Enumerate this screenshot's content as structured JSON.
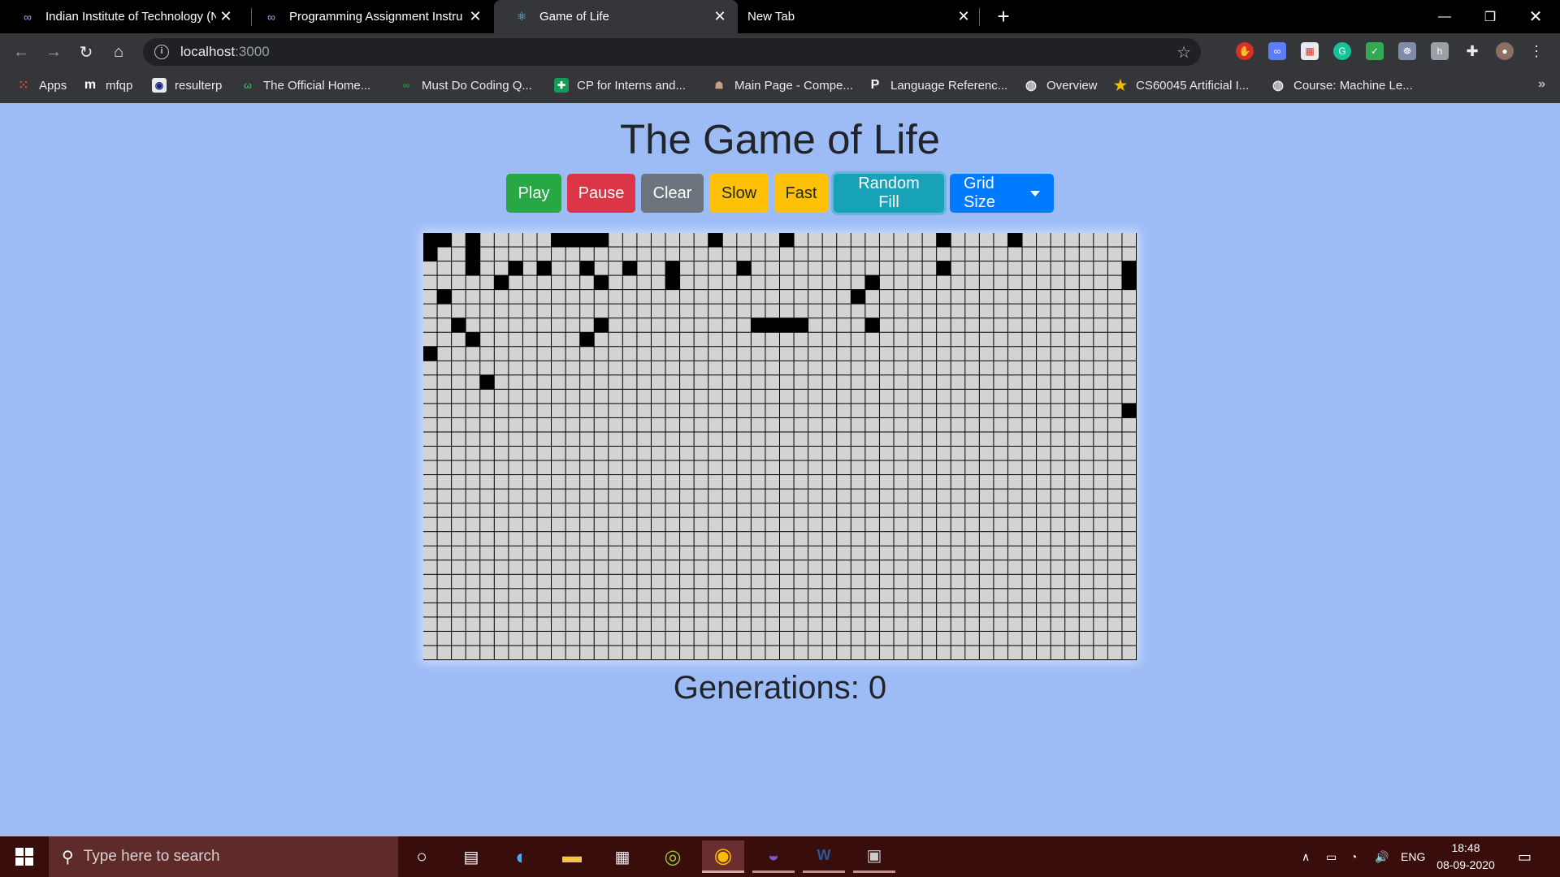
{
  "browser": {
    "tabs": [
      {
        "title": "Indian Institute of Technology (N",
        "icon": "coursera-icon",
        "active": false
      },
      {
        "title": "Programming Assignment Instru",
        "icon": "coursera-icon",
        "active": false
      },
      {
        "title": "Game of Life",
        "icon": "react-icon",
        "active": true
      },
      {
        "title": "New Tab",
        "icon": "",
        "active": false
      }
    ],
    "url_host": "localhost",
    "url_port": ":3000",
    "bookmarks": [
      {
        "label": "Apps",
        "icon": "apps-grid-icon"
      },
      {
        "label": "mfqp",
        "icon": "mfqp-icon"
      },
      {
        "label": "resulterp",
        "icon": "iit-logo-icon"
      },
      {
        "label": "The Official Home...",
        "icon": "site-icon"
      },
      {
        "label": "Must Do Coding Q...",
        "icon": "gfg-icon"
      },
      {
        "label": "CP for Interns and...",
        "icon": "sheets-icon"
      },
      {
        "label": "Main Page - Compe...",
        "icon": "wiki-icon"
      },
      {
        "label": "Language Referenc...",
        "icon": "p-icon"
      },
      {
        "label": "Overview",
        "icon": "globe-icon"
      },
      {
        "label": "CS60045 Artificial I...",
        "icon": "star-icon"
      },
      {
        "label": "Course: Machine Le...",
        "icon": "globe-icon"
      }
    ]
  },
  "page": {
    "title": "The Game of Life",
    "buttons": {
      "play": "Play",
      "pause": "Pause",
      "clear": "Clear",
      "slow": "Slow",
      "fast": "Fast",
      "random_fill": "Random Fill",
      "grid_size": "Grid Size"
    },
    "generations_label": "Generations: 0",
    "grid": {
      "rows": 30,
      "cols": 50,
      "cells": [
        "11010000011110000000100001000000000010000100000000",
        "10010000000000000000000000000000000000000000000000",
        "00010010100100100100001000000000000010000000000001",
        "00000100000010000100000000000001000000000000000001",
        "01000000000000000000000000000010000000000000000000",
        "00000000000000000000000000000000000000000000000000",
        "00100000000010000000000111100001000000000000000000",
        "00010000000100000000000000000000000000000000000000",
        "10000000000000000000000000000000000000000000000000",
        "00000000000000000000000000000000000000000000000000",
        "00001000000000000000000000000000000000000000000000",
        "00000000000000000000000000000000000000000000000000",
        "00000000000000000000000000000000000000000000000001",
        "00000000000000000000000000000000000000000000000000",
        "00000000000000000000000000000000000000000000000000",
        "00000000000000000000000000000000000000000000000000",
        "00000000000000000000000000000000000000000000000000",
        "00000000000000000000000000000000000000000000000000",
        "00000000000000000000000000000000000000000000000000",
        "00000000000000000000000000000000000000000000000000",
        "00000000000000000000000000000000000000000000000000",
        "00000000000000000000000000000000000000000000000000",
        "00000000000000000000000000000000000000000000000000",
        "00000000000000000000000000000000000000000000000000",
        "00000000000000000000000000000000000000000000000000",
        "00000000000000000000000000000000000000000000000000",
        "00000000000000000000000000000000000000000000000000",
        "00000000000000000000000000000000000000000000000000",
        "00000000000000000000000000000000000000000000000000",
        "00000000000000000000000000000000000000000000000000"
      ],
      "alive_color": "#000000",
      "dead_color": "#d3d3d3"
    }
  },
  "taskbar": {
    "search_placeholder": "Type here to search",
    "apps": [
      "cortana-icon",
      "task-view-icon",
      "edge-icon",
      "file-explorer-icon",
      "store-icon",
      "xbox-icon",
      "chrome-icon",
      "eclipse-icon",
      "word-icon",
      "terminal-icon"
    ],
    "language": "ENG",
    "time": "18:48",
    "date": "08-09-2020"
  }
}
